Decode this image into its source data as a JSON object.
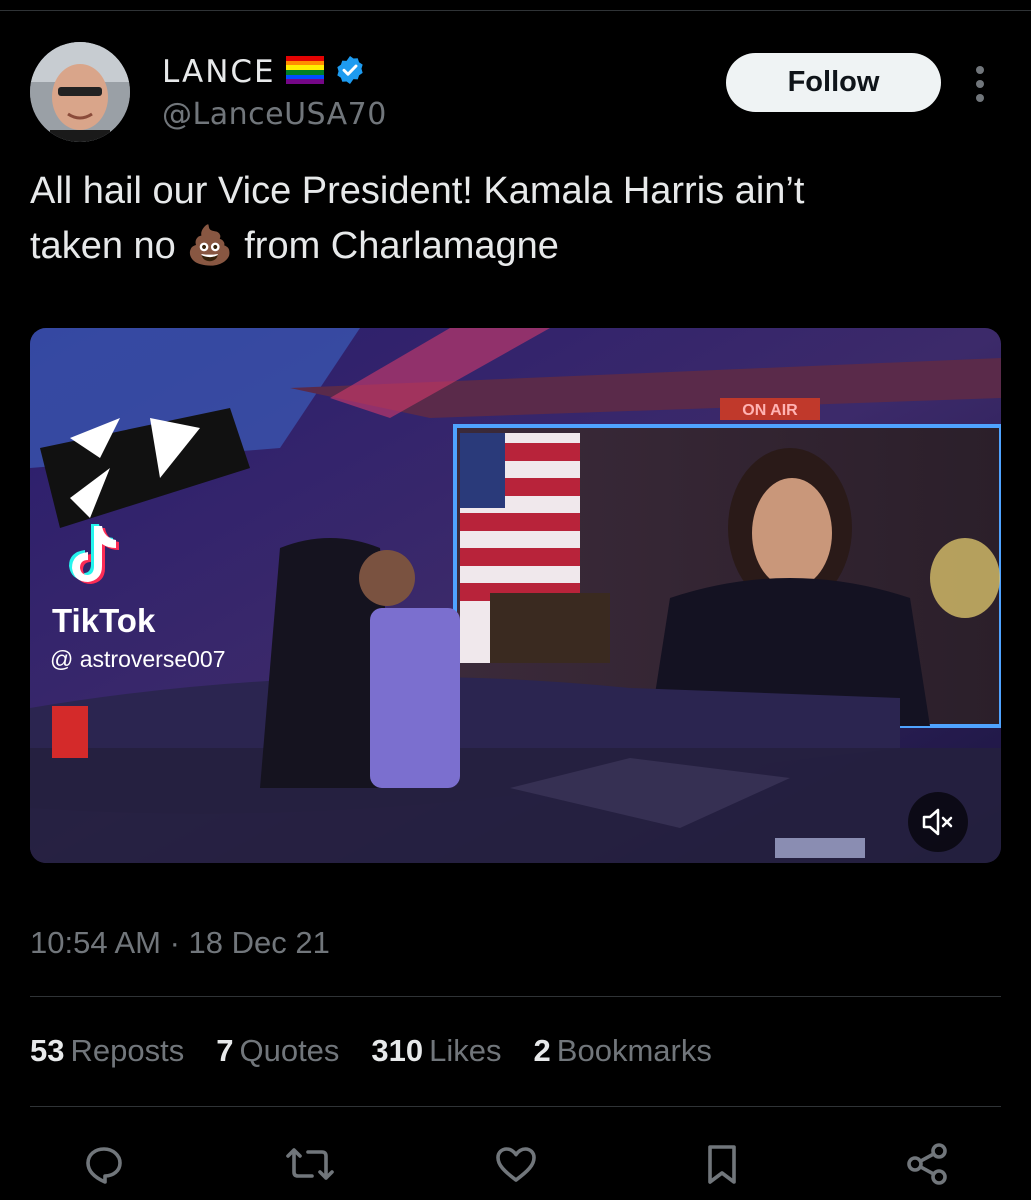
{
  "tweet": {
    "display_name": "LANCE",
    "handle": "@LanceUSA70",
    "follow_label": "Follow",
    "text_line1": "All hail our Vice President! Kamala Harris ain’t",
    "text_line2_a": "taken no ",
    "text_emoji": "💩",
    "text_line2_b": " from Charlamagne",
    "timestamp": "10:54 AM · 18 Dec 21"
  },
  "media": {
    "on_air_label": "ON AIR",
    "tiktok_label": "TikTok",
    "tiktok_user": "@ astroverse007"
  },
  "stats": [
    {
      "count": "53",
      "label": "Reposts"
    },
    {
      "count": "7",
      "label": "Quotes"
    },
    {
      "count": "310",
      "label": "Likes"
    },
    {
      "count": "2",
      "label": "Bookmarks"
    }
  ],
  "icons": {
    "verified": "verified-badge-icon",
    "flag": "rainbow-flag-icon",
    "more": "more-options-icon",
    "mute": "muted-speaker-icon",
    "reply": "reply-icon",
    "repost": "repost-icon",
    "like": "like-icon",
    "bookmark": "bookmark-icon",
    "share": "share-icon"
  },
  "colors": {
    "background": "#000000",
    "text": "#e7e9ea",
    "secondary_text": "#71767b",
    "verified": "#1d9bf0",
    "follow_bg": "#eff3f4"
  }
}
